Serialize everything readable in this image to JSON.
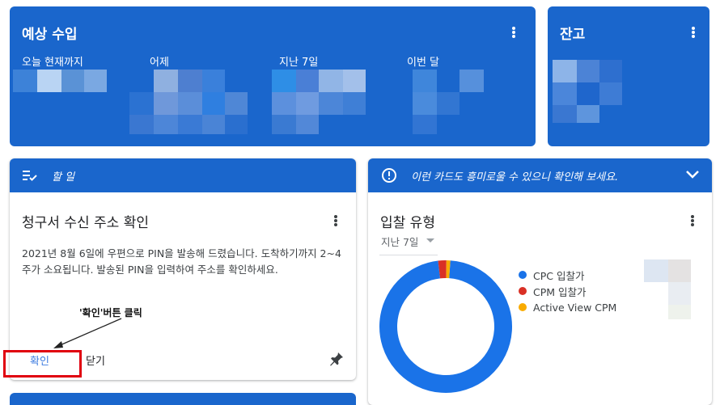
{
  "earnings": {
    "title": "예상 수입",
    "periods": [
      "오늘 현재까지",
      "어제",
      "지난 7일",
      "이번 달"
    ]
  },
  "balance": {
    "title": "잔고"
  },
  "todo": {
    "header": "할 일",
    "task_title": "청구서 수신 주소 확인",
    "task_desc": "2021년 8월 6일에 우편으로 PIN을 발송해 드렸습니다. 도착하기까지 2~4주가 소요됩니다. 발송된 PIN을 입력하여 주소를 확인하세요.",
    "confirm_label": "확인",
    "close_label": "닫기"
  },
  "annotation": "'확인'버튼 클릭",
  "tip": {
    "header": "이런 카드도 흥미로울 수 있으니 확인해 보세요.",
    "card_title": "입찰 유형",
    "range_selected": "지난 7일",
    "legend": [
      {
        "label": "CPC 입찰가",
        "color": "#1a73e8"
      },
      {
        "label": "CPM 입찰가",
        "color": "#d93025"
      },
      {
        "label": "Active View CPM",
        "color": "#f9ab00"
      }
    ]
  },
  "chart_data": {
    "type": "pie",
    "categories": [
      "CPC 입찰가",
      "CPM 입찰가",
      "Active View CPM"
    ],
    "values": [
      97,
      2,
      1
    ]
  }
}
